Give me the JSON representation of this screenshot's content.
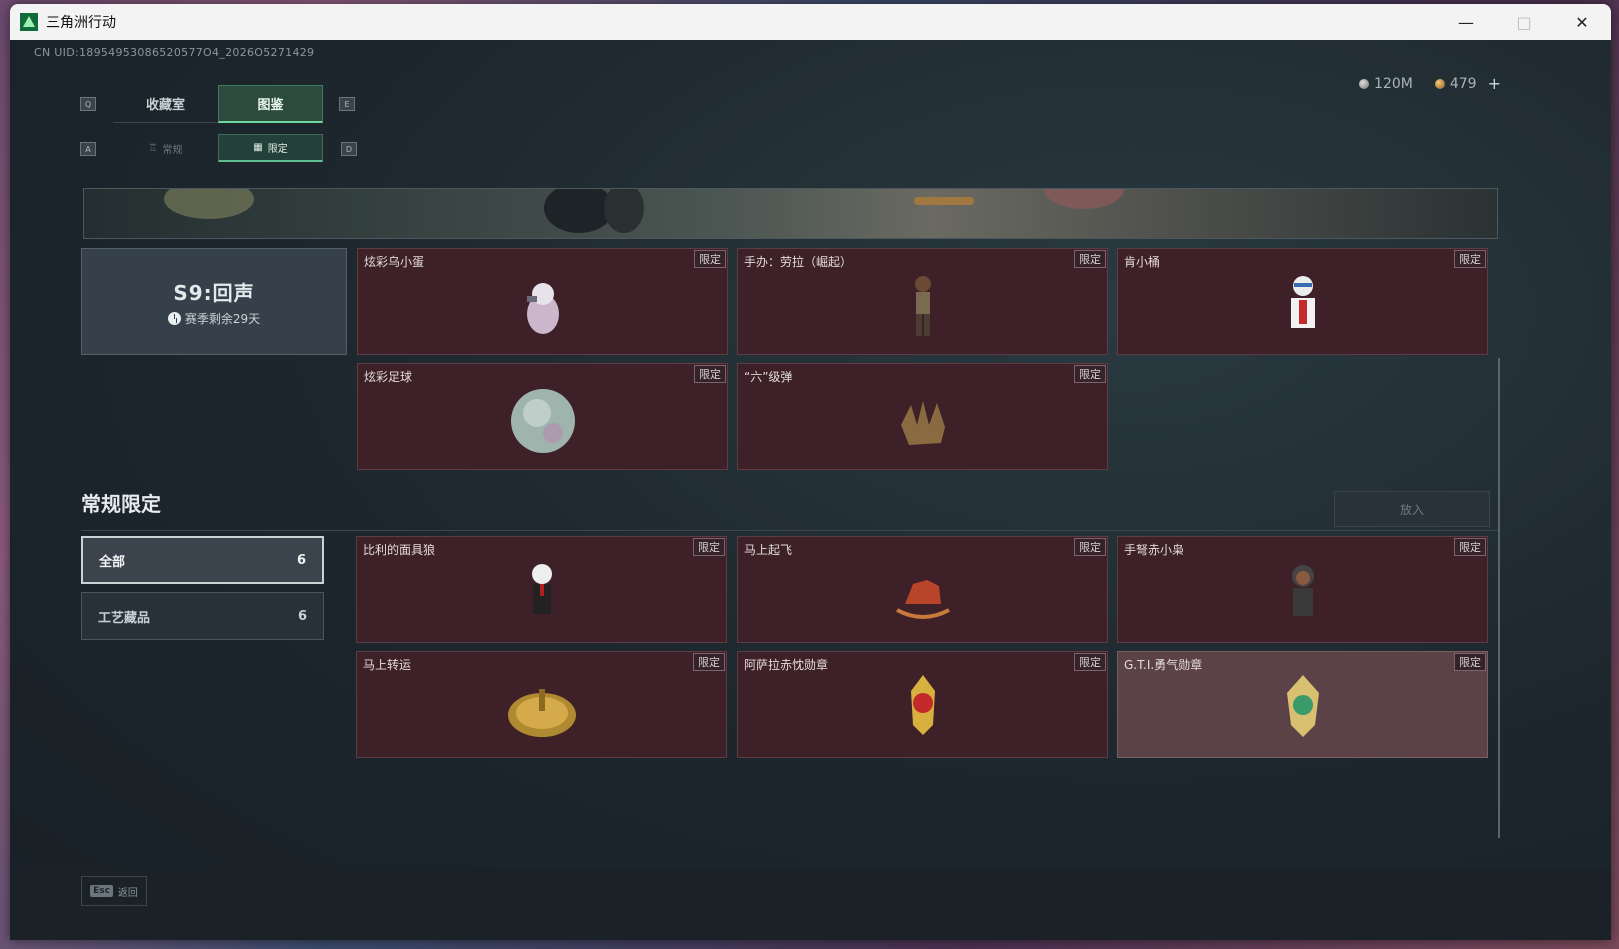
{
  "window": {
    "title": "三角洲行动"
  },
  "uid": "CN UID:18954953086520577O4_2026O5271429",
  "currency": {
    "silver": "120M",
    "gold": "479"
  },
  "top_tabs": {
    "left_key": "Q",
    "right_key": "E",
    "items": [
      {
        "label": "收藏室"
      },
      {
        "label": "图鉴"
      }
    ]
  },
  "sub_tabs": {
    "left_key": "A",
    "right_key": "D",
    "items": [
      {
        "label": "常规"
      },
      {
        "label": "限定"
      }
    ]
  },
  "season": {
    "title": "S9:回声",
    "remaining": "赛季剩余29天"
  },
  "badge_label": "限定",
  "season_items": [
    {
      "name": "炫彩乌小蛋"
    },
    {
      "name": "手办：劳拉（崛起）"
    },
    {
      "name": "肯小桶"
    },
    {
      "name": "炫彩足球"
    },
    {
      "name": "“六”级弹"
    }
  ],
  "regular": {
    "title": "常规限定",
    "action_label": "放入",
    "filters": [
      {
        "label": "全部",
        "count": "6"
      },
      {
        "label": "工艺藏品",
        "count": "6"
      }
    ],
    "items": [
      {
        "name": "比利的面具狼"
      },
      {
        "name": "马上起飞"
      },
      {
        "name": "手弩赤小枭"
      },
      {
        "name": "马上转运"
      },
      {
        "name": "阿萨拉赤忱勋章"
      },
      {
        "name": "G.T.I.勇气勋章"
      }
    ]
  },
  "footer": {
    "key": "Esc",
    "label": "返回"
  }
}
